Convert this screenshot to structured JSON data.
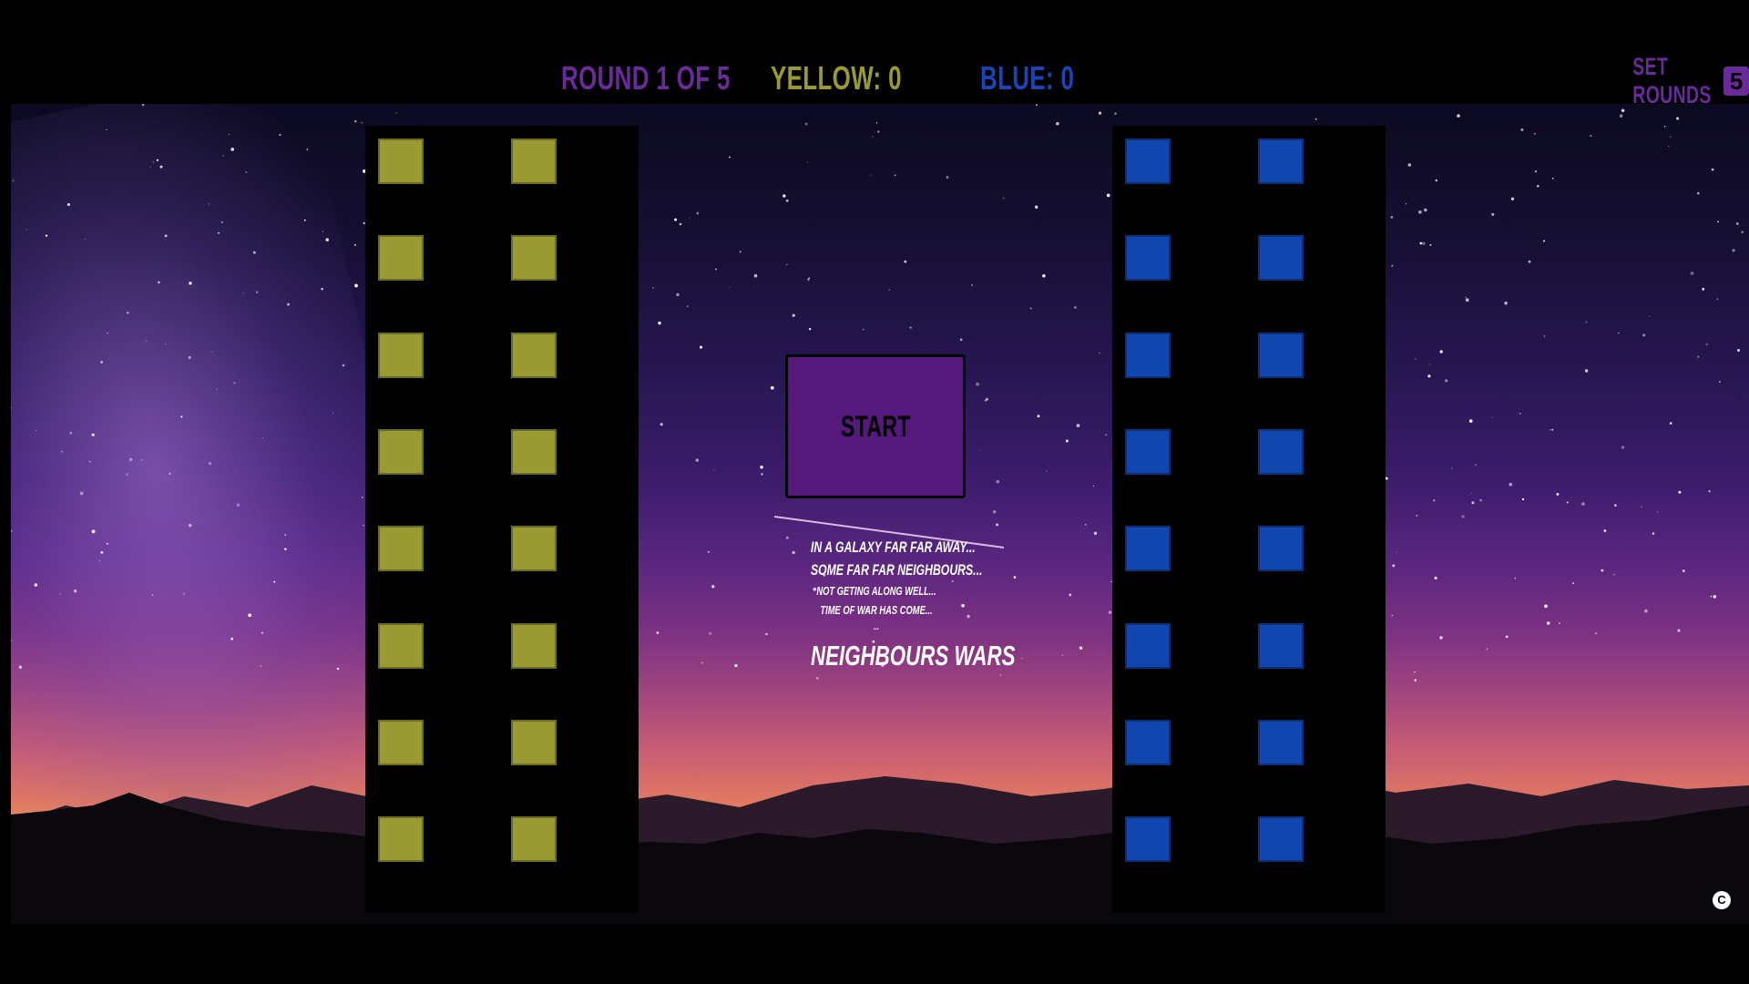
{
  "header": {
    "round_label": "Round 1 of 5",
    "yellow_score": "Yellow: 0",
    "blue_score": "Blue: 0",
    "set_rounds_label": "Set Rounds",
    "rounds_value": "5"
  },
  "start_button": {
    "label": "Start"
  },
  "intro": {
    "line1": "In a galaxy far far away...",
    "line2": "Some far far neighbours...",
    "line3": "Not geting along well...",
    "line4": "Time of war has come...",
    "line5": "...",
    "title": "Neighbours Wars"
  },
  "boards": {
    "yellow": {
      "rows": 8,
      "cols": 2,
      "color": "#9a9a33"
    },
    "blue": {
      "rows": 8,
      "cols": 2,
      "color": "#1046ad"
    }
  },
  "footer": {
    "copyright_symbol": "C"
  },
  "colors": {
    "purple": "#6a2b9a",
    "start_bg": "#54197a",
    "yellow": "#9a9a33",
    "blue": "#1b45b5"
  }
}
